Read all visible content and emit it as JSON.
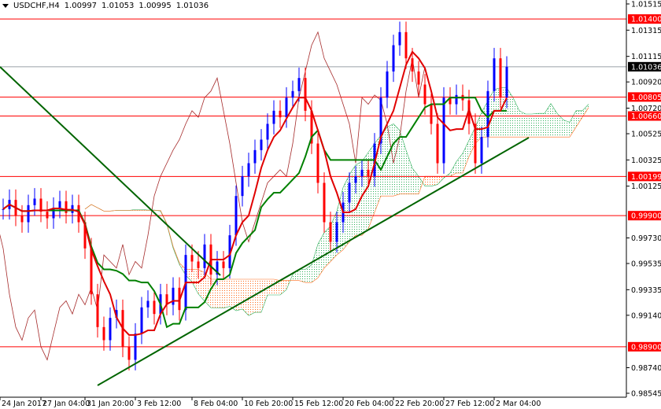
{
  "header": {
    "symbol": "USDCHF,H4",
    "open": "1.00997",
    "high": "1.01053",
    "low": "1.00995",
    "close": "1.01036"
  },
  "chart_data": {
    "type": "line",
    "title": "USDCHF,H4",
    "ylim": [
      0.98545,
      1.01515
    ],
    "y_ticks": [
      "1.01515",
      "1.01315",
      "1.01115",
      "1.00920",
      "1.00720",
      "1.00525",
      "1.00325",
      "1.00125",
      "0.99730",
      "0.99535",
      "0.99335",
      "0.99140",
      "0.98740",
      "0.98545"
    ],
    "x_ticks": [
      {
        "label": "24 Jan 2017",
        "bar": 0
      },
      {
        "label": "27 Jan 04:00",
        "bar": 9
      },
      {
        "label": "31 Jan 20:00",
        "bar": 16
      },
      {
        "label": "3 Feb 12:00",
        "bar": 24
      },
      {
        "label": "8 Feb 04:00",
        "bar": 33
      },
      {
        "label": "10 Feb 20:00",
        "bar": 41
      },
      {
        "label": "15 Feb 12:00",
        "bar": 49
      },
      {
        "label": "20 Feb 04:00",
        "bar": 57
      },
      {
        "label": "22 Feb 20:00",
        "bar": 65
      },
      {
        "label": "27 Feb 12:00",
        "bar": 73
      },
      {
        "label": "2 Mar 04:00",
        "bar": 81
      }
    ],
    "closes": [
      0.9995,
      1.0002,
      0.999,
      0.9985,
      0.9998,
      1.0003,
      0.9993,
      0.9988,
      0.9996,
      1.0001,
      0.9992,
      0.9998,
      0.9985,
      0.9965,
      0.993,
      0.9905,
      0.9895,
      0.9912,
      0.9918,
      0.989,
      0.988,
      0.99,
      0.992,
      0.9925,
      0.9915,
      0.993,
      0.9922,
      0.9935,
      0.9918,
      0.996,
      0.9955,
      0.995,
      0.9968,
      0.9945,
      0.9955,
      0.995,
      0.9975,
      1.0005,
      1.002,
      1.003,
      1.004,
      1.0048,
      1.006,
      1.007,
      1.0065,
      1.008,
      1.0085,
      1.0095,
      1.007,
      1.0045,
      1.0015,
      0.9985,
      0.997,
      0.9985,
      1.0,
      1.0015,
      1.002,
      1.0025,
      1.002,
      1.0045,
      1.008,
      1.01,
      1.012,
      1.013,
      1.011,
      1.01,
      1.009,
      1.0075,
      1.006,
      1.003,
      1.008,
      1.0075,
      1.0082,
      1.0078,
      1.006,
      1.003,
      1.005,
      1.0085,
      1.011,
      1.008,
      1.01036
    ],
    "levels": [
      {
        "price": 1.014,
        "label": "1.01400"
      },
      {
        "price": 1.00805,
        "label": "1.00805"
      },
      {
        "price": 1.0066,
        "label": "1.00660"
      },
      {
        "price": 1.00199,
        "label": "1.00199"
      },
      {
        "price": 0.999,
        "label": "0.99900"
      },
      {
        "price": 0.989,
        "label": "0.98900"
      }
    ],
    "current_price": {
      "price": 1.01036,
      "label": "1.01036"
    },
    "trendlines": [
      {
        "name": "descending",
        "from": [
          -0.5,
          1.01035
        ],
        "to": [
          34.5,
          0.99445
        ]
      },
      {
        "name": "ascending",
        "from": [
          15,
          0.98605
        ],
        "to": [
          83.5,
          1.00495
        ]
      }
    ],
    "ichimoku": {
      "tenkan": 5,
      "kijun": 13,
      "senkou_b": 26,
      "shift": 13
    }
  },
  "colors": {
    "level": "#ff0000",
    "tenkan": "#e00000",
    "kijun": "#008000",
    "chikou": "#a52a2a",
    "bull": "#0000ff",
    "bear": "#ff0000",
    "cloud_up": "#2eae5a",
    "cloud_down": "#ff6a1a",
    "trend": "#006400"
  }
}
